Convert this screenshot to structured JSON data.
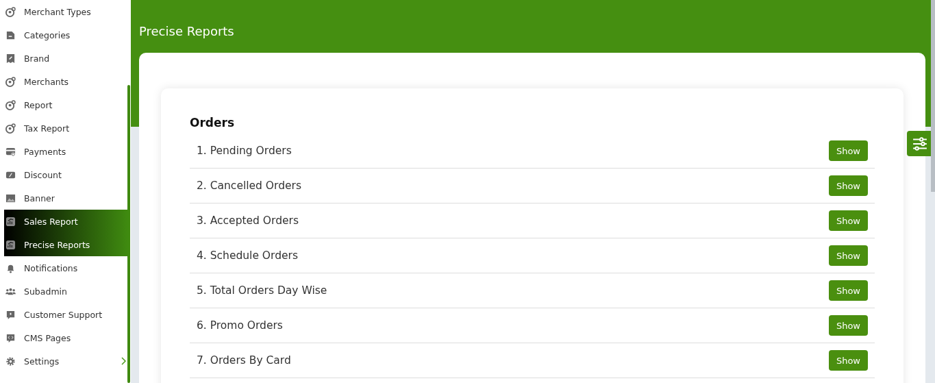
{
  "sidebar": {
    "items": [
      {
        "label": "Merchant Types",
        "kind": "user-gear",
        "selected": false
      },
      {
        "label": "Categories",
        "kind": "document",
        "selected": false
      },
      {
        "label": "Brand",
        "kind": "bookmark",
        "selected": false
      },
      {
        "label": "Merchants",
        "kind": "user-gear",
        "selected": false
      },
      {
        "label": "Report",
        "kind": "user-gear",
        "selected": false
      },
      {
        "label": "Tax Report",
        "kind": "user-gear",
        "selected": false
      },
      {
        "label": "Payments",
        "kind": "card",
        "selected": false
      },
      {
        "label": "Discount",
        "kind": "percent",
        "selected": false
      },
      {
        "label": "Banner",
        "kind": "image",
        "selected": false
      },
      {
        "label": "Sales Report",
        "kind": "chart",
        "selected": true
      },
      {
        "label": "Precise Reports",
        "kind": "chart",
        "selected": true
      },
      {
        "label": "Notifications",
        "kind": "bell",
        "selected": false
      },
      {
        "label": "Subadmin",
        "kind": "users",
        "selected": false
      },
      {
        "label": "Customer Support",
        "kind": "help",
        "selected": false
      },
      {
        "label": "CMS Pages",
        "kind": "code",
        "selected": false
      },
      {
        "label": "Settings",
        "kind": "gear",
        "selected": false,
        "has_submenu": true
      }
    ]
  },
  "header": {
    "title": "Precise Reports"
  },
  "section": {
    "title": "Orders",
    "reports": [
      {
        "label": "1. Pending Orders",
        "button": "Show"
      },
      {
        "label": "2. Cancelled Orders",
        "button": "Show"
      },
      {
        "label": "3. Accepted Orders",
        "button": "Show"
      },
      {
        "label": "4. Schedule Orders",
        "button": "Show"
      },
      {
        "label": "5. Total Orders Day Wise",
        "button": "Show"
      },
      {
        "label": "6. Promo Orders",
        "button": "Show"
      },
      {
        "label": "7. Orders By Card",
        "button": "Show"
      }
    ]
  }
}
